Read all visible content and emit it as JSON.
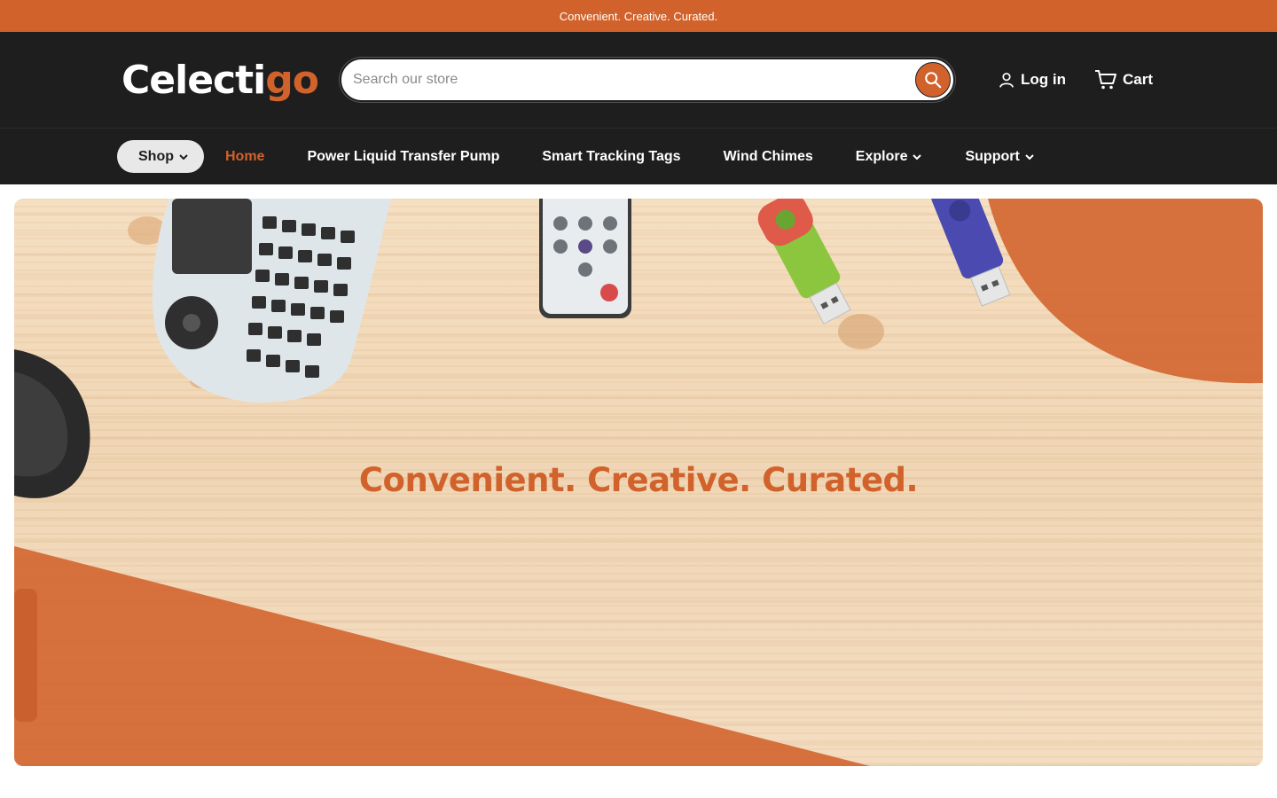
{
  "announcement": "Convenient. Creative. Curated.",
  "brand": {
    "name_main": "Celecti",
    "name_accent": "go",
    "accent_color": "#d1622b"
  },
  "search": {
    "placeholder": "Search our store",
    "icon": "search-icon"
  },
  "header_actions": {
    "login": {
      "label": "Log in",
      "icon": "user-icon"
    },
    "cart": {
      "label": "Cart",
      "icon": "cart-icon"
    }
  },
  "nav": {
    "shop": "Shop",
    "home": "Home",
    "pump": "Power Liquid Transfer Pump",
    "tags": "Smart Tracking Tags",
    "chimes": "Wind Chimes",
    "explore": "Explore",
    "support": "Support"
  },
  "hero": {
    "title": "Convenient. Creative. Curated."
  },
  "colors": {
    "dark": "#1e1e1e",
    "accent": "#d1622b",
    "wood": "#f3dcc0"
  }
}
